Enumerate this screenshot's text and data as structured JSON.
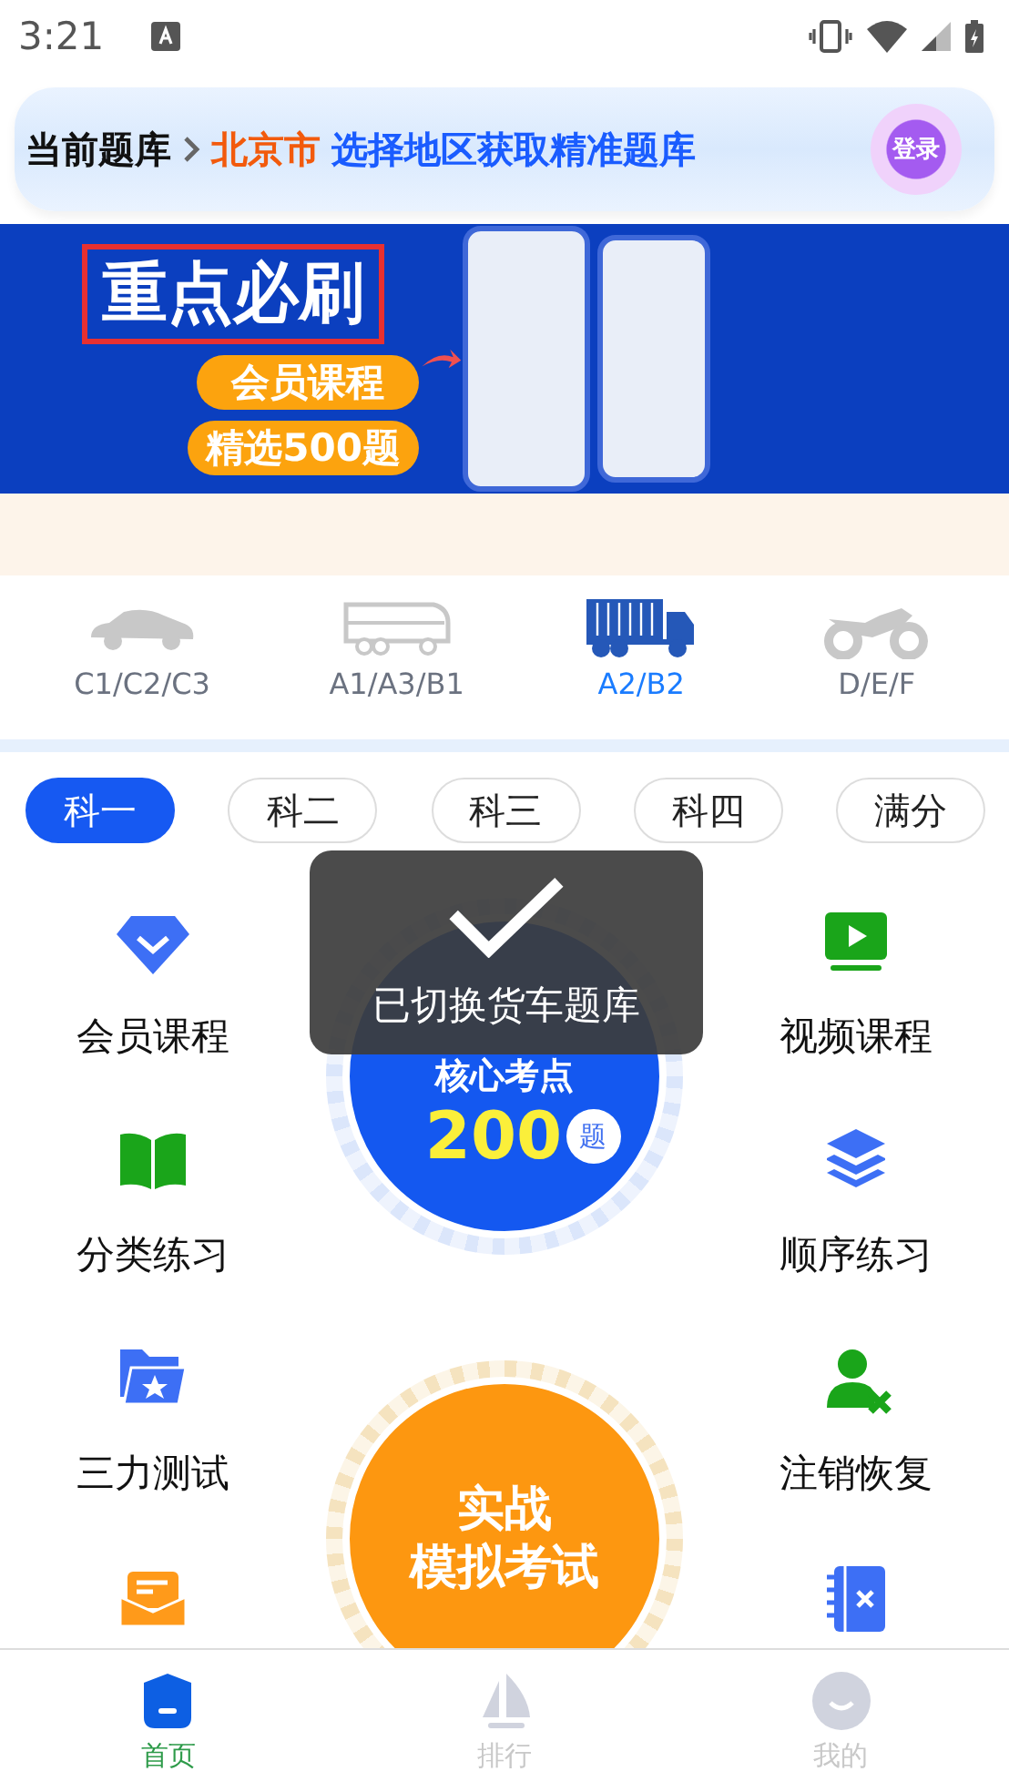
{
  "status_bar": {
    "time": "3:21"
  },
  "header": {
    "label": "当前题库",
    "city": "北京市",
    "prompt": "选择地区获取精准题库",
    "login": "登录"
  },
  "banner": {
    "title": "重点必刷",
    "tags": [
      "会员课程",
      "精选500题"
    ]
  },
  "vehicle_tabs": [
    {
      "label": "C1/C2/C3",
      "selected": false
    },
    {
      "label": "A1/A3/B1",
      "selected": false
    },
    {
      "label": "A2/B2",
      "selected": true
    },
    {
      "label": "D/E/F",
      "selected": false
    }
  ],
  "subject_tabs": [
    {
      "label": "科一",
      "selected": true
    },
    {
      "label": "科二",
      "selected": false
    },
    {
      "label": "科三",
      "selected": false
    },
    {
      "label": "科四",
      "selected": false
    },
    {
      "label": "满分",
      "selected": false
    }
  ],
  "left_features": [
    "会员课程",
    "分类练习",
    "三力测试"
  ],
  "right_features": [
    "视频课程",
    "顺序练习",
    "注销恢复"
  ],
  "key_points": {
    "title": "核心考点",
    "count": "200",
    "unit": "题"
  },
  "mock_exam": {
    "lines": [
      "实战",
      "模拟考试"
    ]
  },
  "toast": {
    "message": "已切换货车题库"
  },
  "bottom_nav": [
    {
      "label": "首页",
      "selected": true
    },
    {
      "label": "排行",
      "selected": false
    },
    {
      "label": "我的",
      "selected": false
    }
  ]
}
